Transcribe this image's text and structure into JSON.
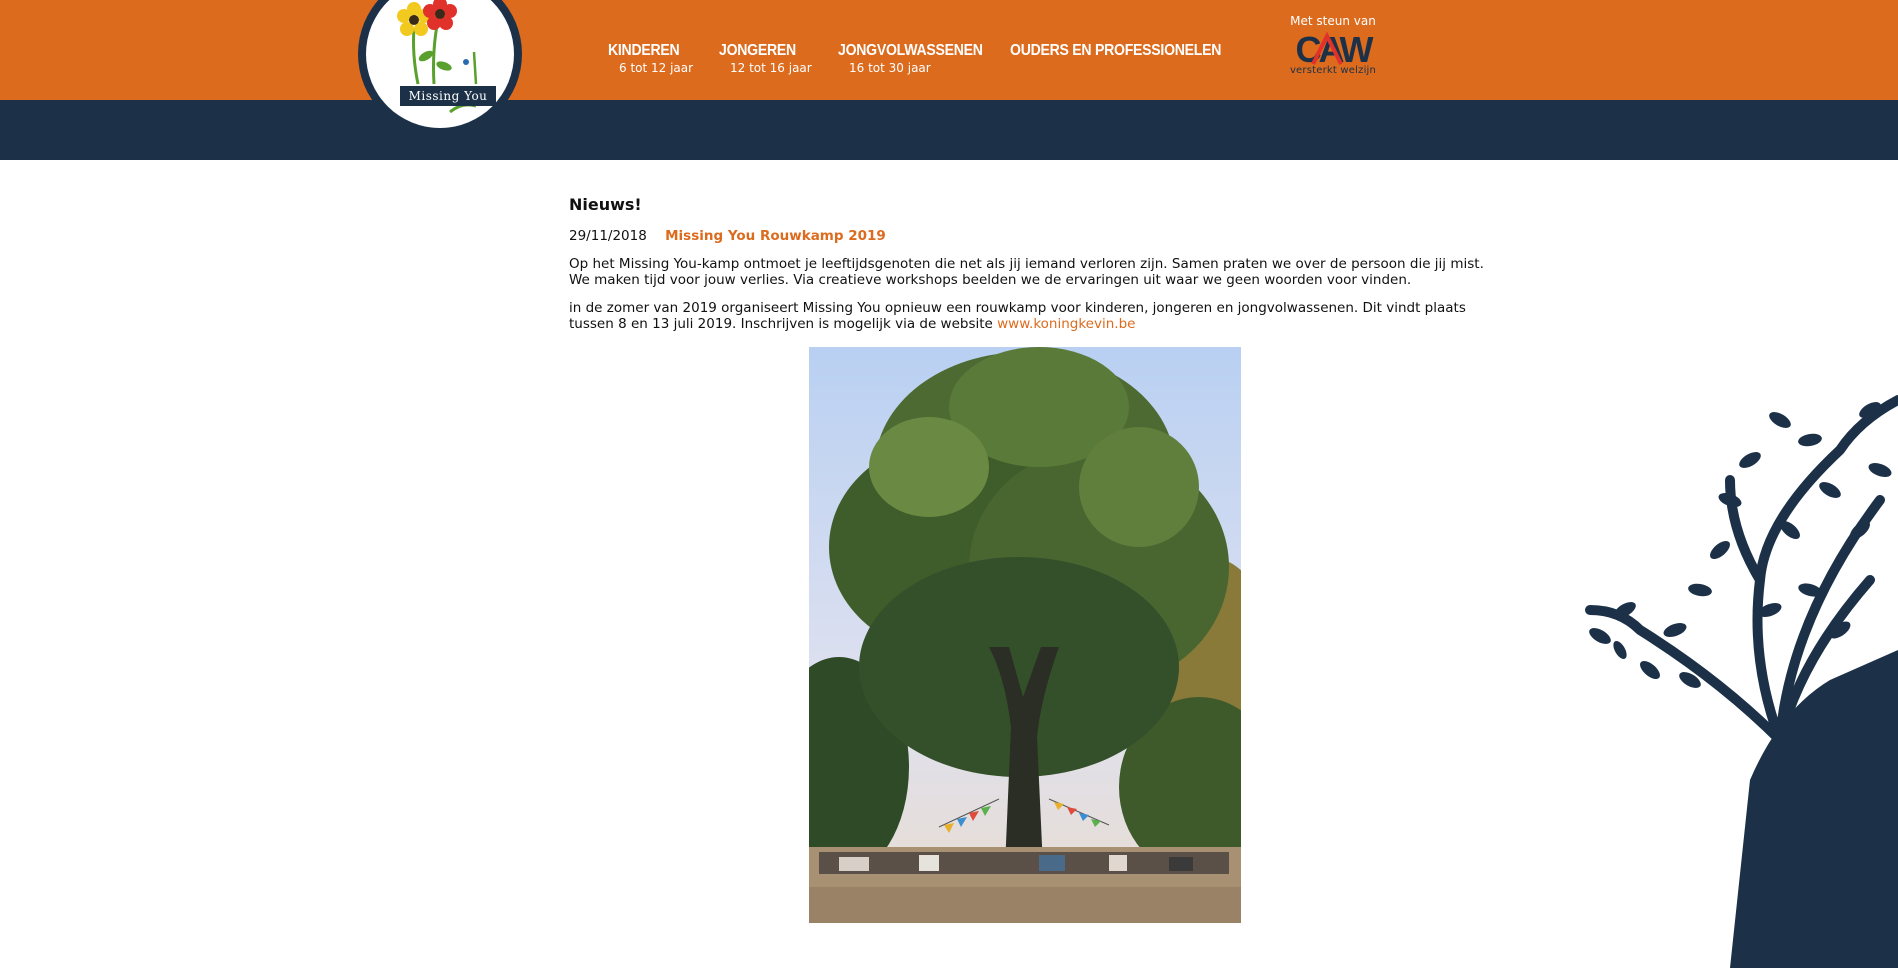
{
  "colors": {
    "brand_orange": "#dc6b1e",
    "navy": "#1c3148"
  },
  "logo": {
    "text": "Missing You"
  },
  "nav": [
    {
      "label": "Kinderen",
      "sub": "6 tot 12 jaar"
    },
    {
      "label": "Jongeren",
      "sub": "12 tot 16 jaar"
    },
    {
      "label": "Jongvolwassenen",
      "sub": "16 tot 30 jaar"
    },
    {
      "label": "Ouders en professionelen",
      "sub": ""
    }
  ],
  "support": {
    "label": "Met steun van",
    "logo_text": "CAW",
    "tagline": "versterkt welzijn"
  },
  "news": {
    "heading": "Nieuws!",
    "date": "29/11/2018",
    "title": "Missing You Rouwkamp 2019",
    "paragraph1": "Op het Missing You-kamp ontmoet je leeftijdsgenoten die net als jij iemand verloren zijn. Samen praten we over de persoon die jij mist. We maken tijd voor jouw verlies. Via creatieve workshops beelden we de ervaringen uit waar we geen woorden voor vinden.",
    "paragraph2": "in de zomer van 2019 organiseert Missing You opnieuw een rouwkamp voor kinderen, jongeren en jongvolwassenen. Dit vindt plaats tussen 8 en 13 juli 2019. Inschrijven is mogelijk via de website ",
    "link": "www.koningkevin.be"
  },
  "icons": {
    "logo": "flower-logo-icon",
    "photo": "camp-photo-tree",
    "decoration": "tree-silhouette-icon"
  }
}
